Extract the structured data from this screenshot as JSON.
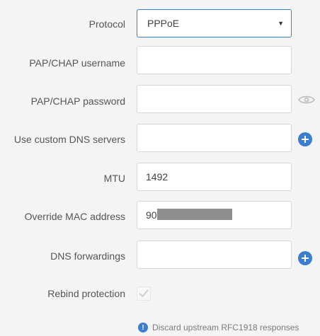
{
  "form": {
    "protocol": {
      "label": "Protocol",
      "selected": "PPPoE"
    },
    "pap_chap_username": {
      "label": "PAP/CHAP username",
      "value": ""
    },
    "pap_chap_password": {
      "label": "PAP/CHAP password",
      "value": ""
    },
    "custom_dns": {
      "label": "Use custom DNS servers",
      "value": ""
    },
    "mtu": {
      "label": "MTU",
      "value": "1492"
    },
    "override_mac": {
      "label": "Override MAC address",
      "value": "90"
    },
    "dns_forwardings": {
      "label": "DNS forwardings",
      "value": ""
    },
    "rebind_protection": {
      "label": "Rebind protection",
      "checked": true,
      "hint": "Discard upstream RFC1918 responses"
    }
  },
  "colors": {
    "accent": "#3b7ed0",
    "select_border": "#3c7ec4",
    "background": "#f4f4f4"
  },
  "icons": {
    "select_caret": "caret-down-icon",
    "password_reveal": "eye-icon",
    "add": "plus-icon",
    "info": "info-icon",
    "check": "check-icon"
  }
}
